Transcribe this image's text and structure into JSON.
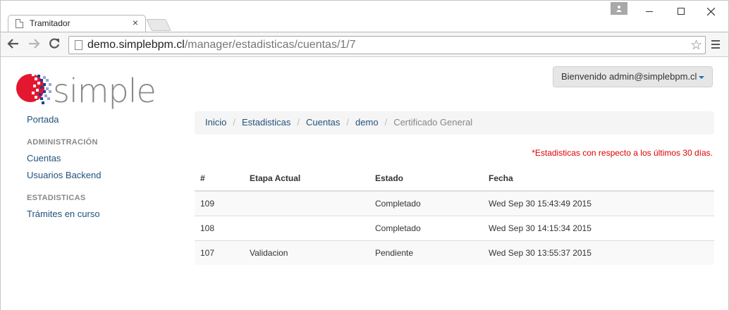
{
  "browser": {
    "tab_title": "Tramitador",
    "tab_close": "×",
    "url_host": "demo.simplebpm.cl",
    "url_path": "/manager/estadisticas/cuentas/1/7",
    "star": "☆"
  },
  "header": {
    "logo_text": "simple",
    "user_menu_label": "Bienvenido admin@simplebpm.cl"
  },
  "sidebar": {
    "home": "Portada",
    "sections": [
      {
        "title": "ADMINISTRACIÓN",
        "items": [
          "Cuentas",
          "Usuarios Backend"
        ]
      },
      {
        "title": "ESTADISTICAS",
        "items": [
          "Trámites en curso"
        ]
      }
    ]
  },
  "breadcrumb": {
    "items": [
      "Inicio",
      "Estadisticas",
      "Cuentas",
      "demo"
    ],
    "active": "Certificado General",
    "separator": "/"
  },
  "notice": "*Estadisticas con respecto a los últimos 30 días.",
  "table": {
    "headers": [
      "#",
      "Etapa Actual",
      "Estado",
      "Fecha"
    ],
    "rows": [
      [
        "109",
        "",
        "Completado",
        "Wed Sep 30 15:43:49 2015"
      ],
      [
        "108",
        "",
        "Completado",
        "Wed Sep 30 14:15:34 2015"
      ],
      [
        "107",
        "Validacion",
        "Pendiente",
        "Wed Sep 30 13:55:37 2015"
      ]
    ]
  },
  "colors": {
    "link": "#21527e",
    "notice": "#e00000",
    "logo_red": "#e3172f",
    "logo_blue": "#1f3f96"
  }
}
